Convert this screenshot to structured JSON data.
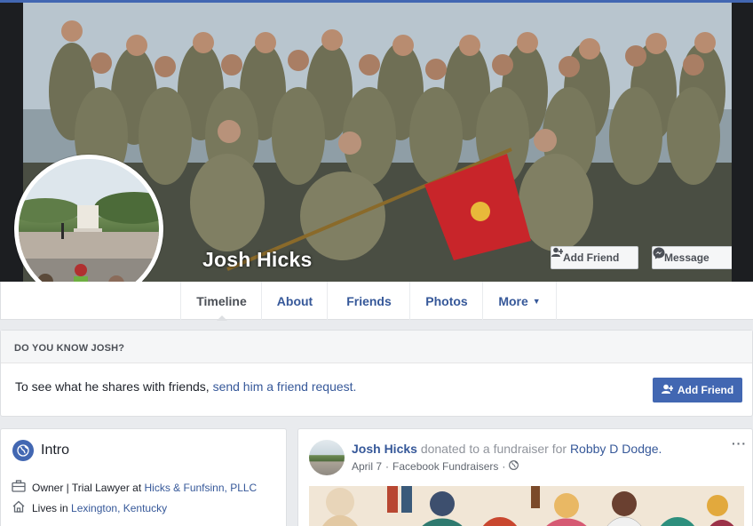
{
  "profile": {
    "name": "Josh Hicks"
  },
  "cover_actions": {
    "add_friend": "Add Friend",
    "message": "Message",
    "more": "···"
  },
  "tabs": [
    {
      "label": "Timeline",
      "active": true
    },
    {
      "label": "About"
    },
    {
      "label": "Friends"
    },
    {
      "label": "Photos"
    },
    {
      "label": "More"
    }
  ],
  "know_card": {
    "heading": "DO YOU KNOW JOSH?",
    "text": "To see what he shares with friends, ",
    "link": "send him a friend request.",
    "button": "Add Friend"
  },
  "intro": {
    "title": "Intro",
    "work_prefix": "Owner | Trial Lawyer at ",
    "work_link": "Hicks & Funfsinn, PLLC",
    "lives_prefix": "Lives in ",
    "lives_link": "Lexington, Kentucky"
  },
  "post": {
    "author": "Josh Hicks",
    "action": " donated to a fundraiser for ",
    "target": "Robby D Dodge.",
    "date": "April 7",
    "separator": "·",
    "source": "Facebook Fundraisers",
    "menu": "···"
  },
  "colors": {
    "brand_blue": "#4267b2",
    "link_blue": "#365899",
    "flag_red": "#c8252a"
  }
}
